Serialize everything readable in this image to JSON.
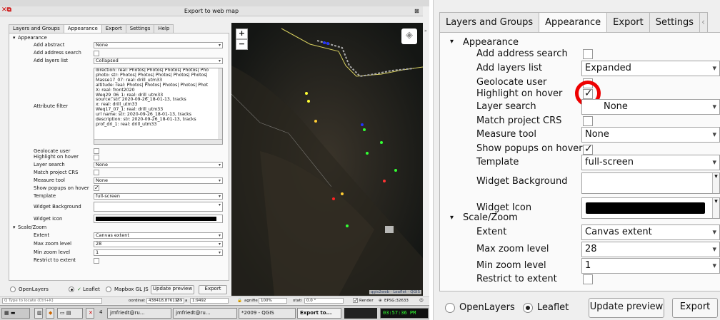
{
  "window": {
    "title": "Export to web map"
  },
  "tabs": [
    "Layers and Groups",
    "Appearance",
    "Export",
    "Settings",
    "Help"
  ],
  "left": {
    "appearance_label": "Appearance",
    "add_abstract": {
      "label": "Add abstract",
      "value": "None"
    },
    "add_address_search": {
      "label": "Add address search"
    },
    "add_layers_list": {
      "label": "Add layers list",
      "value": "Collapsed"
    },
    "attribute_filter": {
      "label": "Attribute filter",
      "items": [
        "direction: real: Photos| Photos| Photos| Photos| Pho",
        "photo: str: Photos| Photos| Photos| Photos| Photos|",
        "Masse17_07: real: drill_utm33",
        "altitude: real: Photos| Photos| Photos| Photos| Phot",
        "X: real: front2020",
        "Weq29_06_1: real: drill_utm33",
        "source: str: 2020-09-26_18-01-13, tracks",
        "x: real: drill_utm33",
        "Weq17_07_1: real: drill_utm33",
        "url name: str: 2020-09-26_18-01-13, tracks",
        "description: str: 2020-09-26_18-01-13, tracks",
        "prof_dri_1: real: drill_utm33"
      ]
    },
    "geolocate_user": {
      "label": "Geolocate user"
    },
    "highlight_on_hover": {
      "label": "Highlight on hover"
    },
    "layer_search": {
      "label": "Layer search",
      "value": "None"
    },
    "match_project_crs": {
      "label": "Match project CRS"
    },
    "measure_tool": {
      "label": "Measure tool",
      "value": "None"
    },
    "show_popups": {
      "label": "Show popups on hover",
      "checked": true
    },
    "template": {
      "label": "Template",
      "value": "full-screen"
    },
    "widget_background": {
      "label": "Widget Background"
    },
    "widget_icon": {
      "label": "Widget Icon"
    },
    "scale_zoom_label": "Scale/Zoom",
    "extent": {
      "label": "Extent",
      "value": "Canvas extent"
    },
    "max_zoom": {
      "label": "Max zoom level",
      "value": "28"
    },
    "min_zoom": {
      "label": "Min zoom level",
      "value": "1"
    },
    "restrict_extent": {
      "label": "Restrict to extent"
    },
    "bottom": {
      "openlayers": "OpenLayers",
      "leaflet": "Leaflet",
      "mapbox": "Mapbox GL JS",
      "update_preview": "Update preview",
      "export": "Export"
    },
    "map": {
      "zoom_in": "+",
      "zoom_out": "−",
      "attribution": "qgis2web · Leaflet · QGIS"
    },
    "status": {
      "locate_placeholder": "Q Type to locate (Ctrl+K)",
      "coordinate_label": "oordinat",
      "coordinate": "438418,8761139",
      "scale_label": "a",
      "scale": "1:9492",
      "magnifier_label": "agnifie",
      "magnifier": "100%",
      "rotation_label": "otati",
      "rotation": "0.0 °",
      "render": "Render",
      "crs": "EPSG:32633"
    },
    "taskbar": {
      "num": "4",
      "t1": "jmfriedt@ru...",
      "t2": "jmfriedt@ru...",
      "t3": "*2009 - QGIS",
      "t4": "Export to...",
      "clock": "03:57:36 PM"
    }
  },
  "right": {
    "tabs": [
      "Layers and Groups",
      "Appearance",
      "Export",
      "Settings"
    ],
    "appearance_label": "Appearance",
    "add_address_search": "Add address search",
    "add_layers_list": {
      "label": "Add layers list",
      "value": "Expanded"
    },
    "geolocate_user": "Geolocate user",
    "highlight_on_hover": "Highlight on hover",
    "layer_search": {
      "label": "Layer search",
      "value": "None"
    },
    "match_project_crs": "Match project CRS",
    "measure_tool": {
      "label": "Measure tool",
      "value": "None"
    },
    "show_popups": "Show popups on hover",
    "template": {
      "label": "Template",
      "value": "full-screen"
    },
    "widget_background": "Widget Background",
    "widget_icon": "Widget Icon",
    "scale_zoom_label": "Scale/Zoom",
    "extent": {
      "label": "Extent",
      "value": "Canvas extent"
    },
    "max_zoom": {
      "label": "Max zoom level",
      "value": "28"
    },
    "min_zoom": {
      "label": "Min zoom level",
      "value": "1"
    },
    "restrict_extent": "Restrict to extent",
    "bottom": {
      "openlayers": "OpenLayers",
      "leaflet": "Leaflet",
      "update_preview": "Update preview",
      "export": "Export"
    }
  },
  "colors": {
    "highlight_circle": "#ee0000",
    "map_bg": "#161917",
    "track": "#e8e060"
  }
}
